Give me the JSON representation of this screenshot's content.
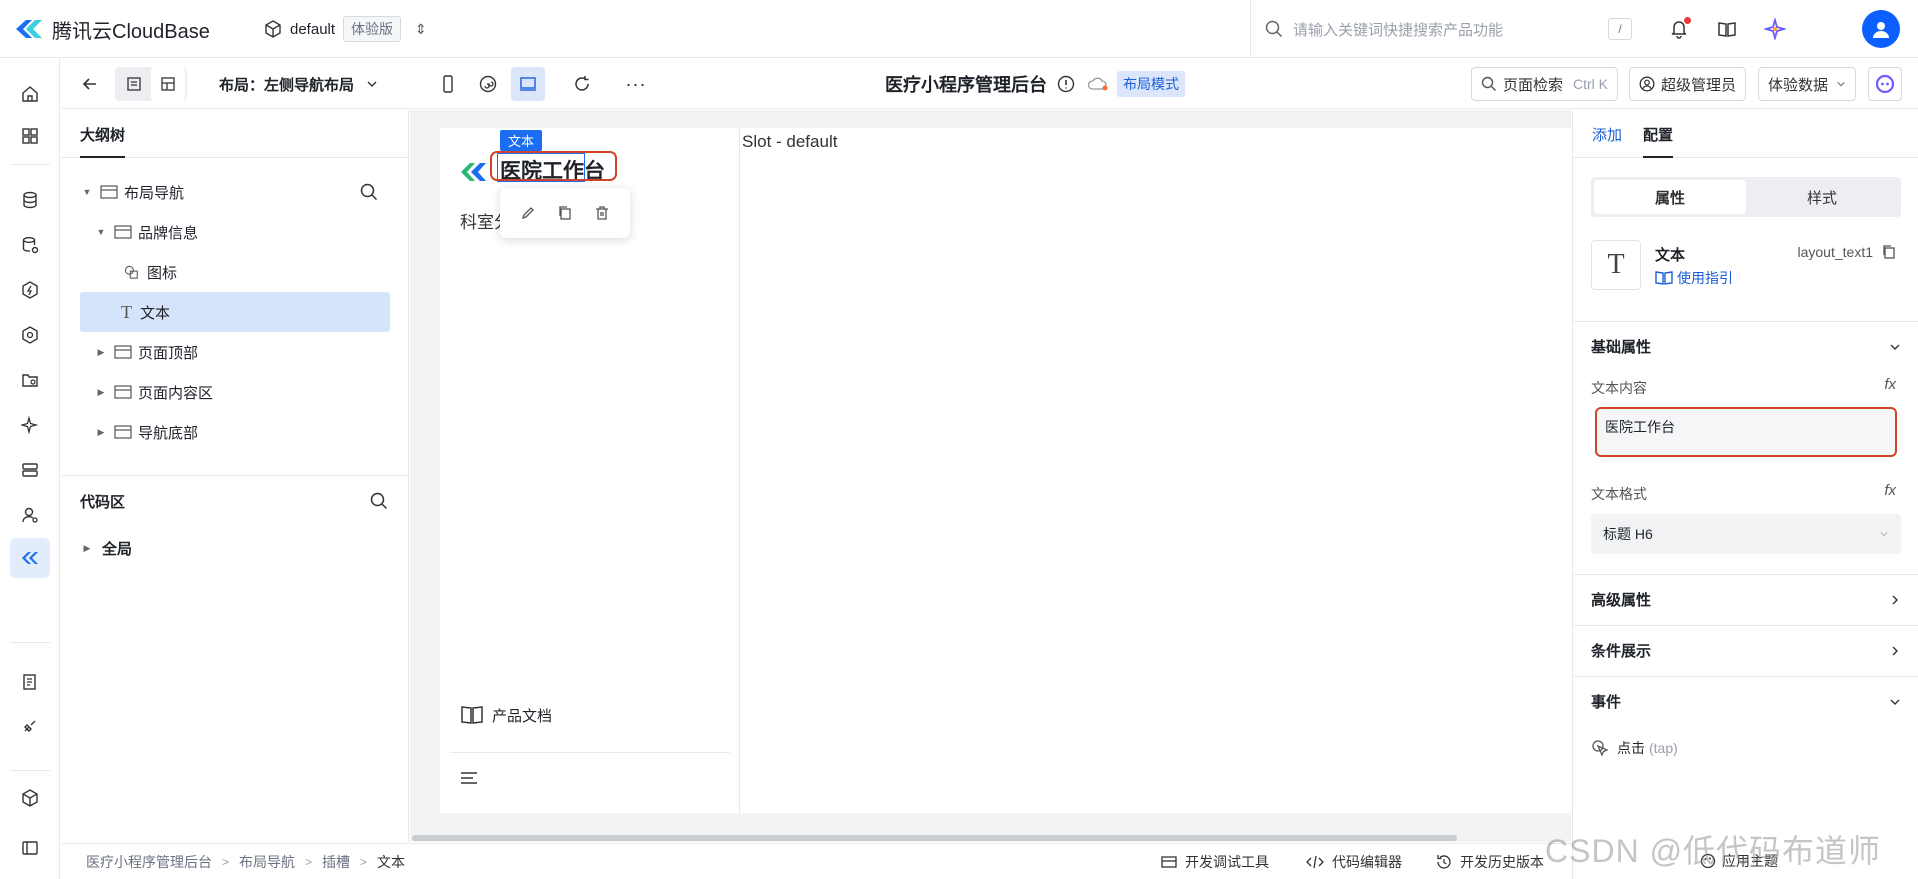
{
  "topbar": {
    "brand_name": "腾讯云CloudBase",
    "env_name": "default",
    "env_badge": "体验版",
    "search_placeholder": "请输入关键词快捷搜索产品功能",
    "search_shortcut": "/"
  },
  "toolbar": {
    "layout_label": "布局：左侧导航布局",
    "page_title": "医疗小程序管理后台",
    "mode_badge": "布局模式",
    "page_search": "页面检索",
    "page_search_kbd": "Ctrl K",
    "admin_label": "超级管理员",
    "data_label": "体验数据"
  },
  "outline": {
    "tab": "大纲树",
    "tree": [
      {
        "label": "布局导航",
        "level": 0,
        "expanded": true
      },
      {
        "label": "品牌信息",
        "level": 1,
        "expanded": true
      },
      {
        "label": "图标",
        "level": 2
      },
      {
        "label": "文本",
        "level": 2,
        "selected": true
      },
      {
        "label": "页面顶部",
        "level": 1,
        "expanded": false
      },
      {
        "label": "页面内容区",
        "level": 1,
        "expanded": false
      },
      {
        "label": "导航底部",
        "level": 1,
        "expanded": false
      }
    ],
    "code_area_title": "代码区",
    "code_item": "全局"
  },
  "canvas": {
    "selected_label": "文本",
    "brand_text": "医院工作台",
    "dept_text": "科室分",
    "doc_link": "产品文档",
    "slot_label": "Slot - default"
  },
  "rpanel": {
    "tabs": [
      "添加",
      "配置"
    ],
    "seg": [
      "属性",
      "样式"
    ],
    "comp_name": "文本",
    "comp_id": "layout_text1",
    "guide_link": "使用指引",
    "basic_props": "基础属性",
    "text_content_label": "文本内容",
    "text_content_value": "医院工作台",
    "text_format_label": "文本格式",
    "text_format_value": "标题 H6",
    "advanced_props": "高级属性",
    "condition": "条件展示",
    "events": "事件",
    "event_tap": "点击",
    "event_tap_code": "(tap)"
  },
  "bottombar": {
    "breadcrumb": [
      "医疗小程序管理后台",
      "布局导航",
      "插槽",
      "文本"
    ],
    "dev_tools": "开发调试工具",
    "code_editor": "代码编辑器",
    "history": "开发历史版本",
    "theme": "应用主题"
  },
  "watermark": "CSDN @低代码布道师",
  "colors": {
    "accent": "#1b6ef3",
    "highlight_red": "#d0452a",
    "selected_bg": "#d5e3fb"
  }
}
